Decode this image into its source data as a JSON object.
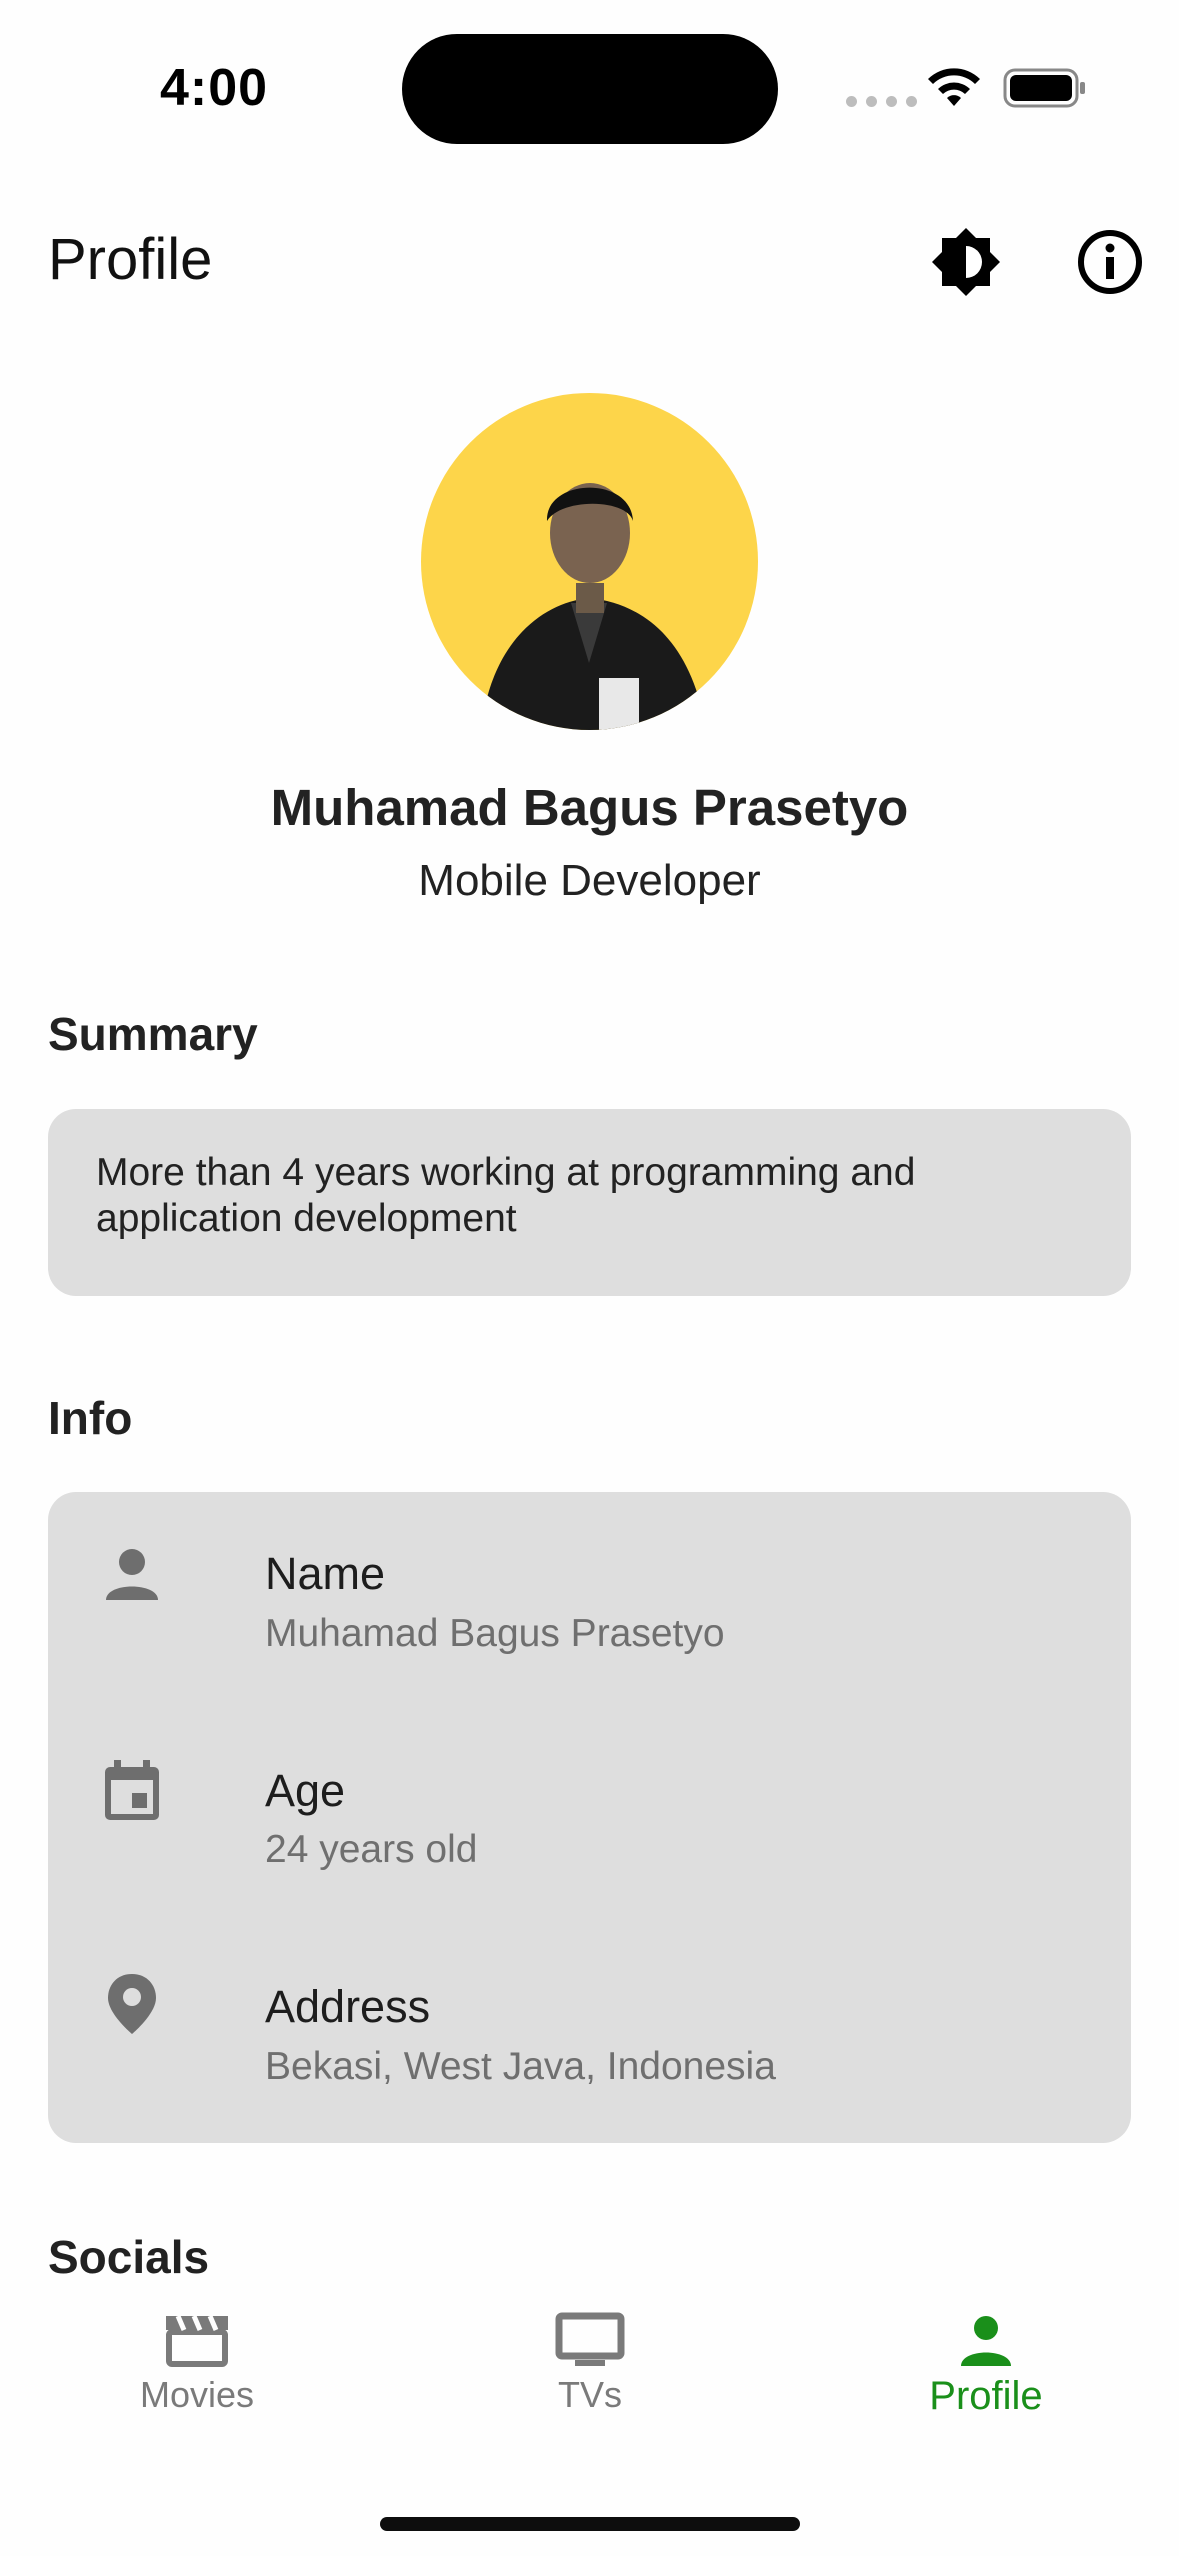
{
  "status_bar": {
    "time": "4:00"
  },
  "header": {
    "title": "Profile",
    "theme_icon": "brightness-icon",
    "about_icon": "info-icon"
  },
  "profile": {
    "name": "Muhamad Bagus Prasetyo",
    "role": "Mobile Developer"
  },
  "summary": {
    "title": "Summary",
    "text": "More than 4 years working at programming and application development"
  },
  "info": {
    "title": "Info",
    "items": [
      {
        "icon": "person-icon",
        "label": "Name",
        "value": "Muhamad Bagus Prasetyo"
      },
      {
        "icon": "calendar-icon",
        "label": "Age",
        "value": "24 years old"
      },
      {
        "icon": "location-pin-icon",
        "label": "Address",
        "value": "Bekasi, West Java, Indonesia"
      }
    ]
  },
  "socials": {
    "title": "Socials"
  },
  "bottom_nav": {
    "items": [
      {
        "label": "Movies",
        "icon": "clapperboard-icon",
        "active": false
      },
      {
        "label": "TVs",
        "icon": "tv-icon",
        "active": false
      },
      {
        "label": "Profile",
        "icon": "person-icon",
        "active": true
      }
    ]
  },
  "colors": {
    "accent": "#1a8f1a",
    "avatar_bg": "#fdd54a",
    "card_bg": "#dedede"
  }
}
